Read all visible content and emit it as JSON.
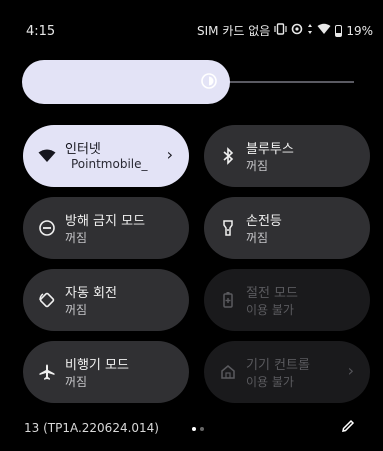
{
  "status_bar": {
    "time": "4:15",
    "sim_text": "SIM 카드 없음",
    "battery": "19%",
    "icons": [
      "vibrate-icon",
      "data-saver-icon",
      "data-transfer-icon",
      "wifi-icon",
      "battery-icon"
    ]
  },
  "brightness": {
    "level": 0.6,
    "icon": "brightness-icon"
  },
  "tiles": [
    {
      "title": "인터넷",
      "subtitle": "Pointmobile_",
      "icon": "wifi-icon",
      "state": "active",
      "has_chevron": true
    },
    {
      "title": "블루투스",
      "subtitle": "꺼짐",
      "icon": "bluetooth-icon",
      "state": "off"
    },
    {
      "title": "방해 금지 모드",
      "subtitle": "꺼짐",
      "icon": "do-not-disturb-icon",
      "state": "off"
    },
    {
      "title": "손전등",
      "subtitle": "꺼짐",
      "icon": "flashlight-icon",
      "state": "off"
    },
    {
      "title": "자동 회전",
      "subtitle": "꺼짐",
      "icon": "auto-rotate-icon",
      "state": "off"
    },
    {
      "title": "절전 모드",
      "subtitle": "이용 불가",
      "icon": "battery-saver-icon",
      "state": "unavailable"
    },
    {
      "title": "비행기 모드",
      "subtitle": "꺼짐",
      "icon": "airplane-icon",
      "state": "off"
    },
    {
      "title": "기기 컨트롤",
      "subtitle": "이용 불가",
      "icon": "home-control-icon",
      "state": "unavailable",
      "has_chevron": true
    }
  ],
  "chevron": "›",
  "footer": {
    "build": "13 (TP1A.220624.014)",
    "page_index": 0,
    "page_count": 2,
    "edit_icon": "pencil-icon"
  },
  "colors": {
    "active_tile": "#e3e3f6",
    "tile": "#303033",
    "disabled_tile": "#1a1a1c",
    "background": "#000000"
  }
}
